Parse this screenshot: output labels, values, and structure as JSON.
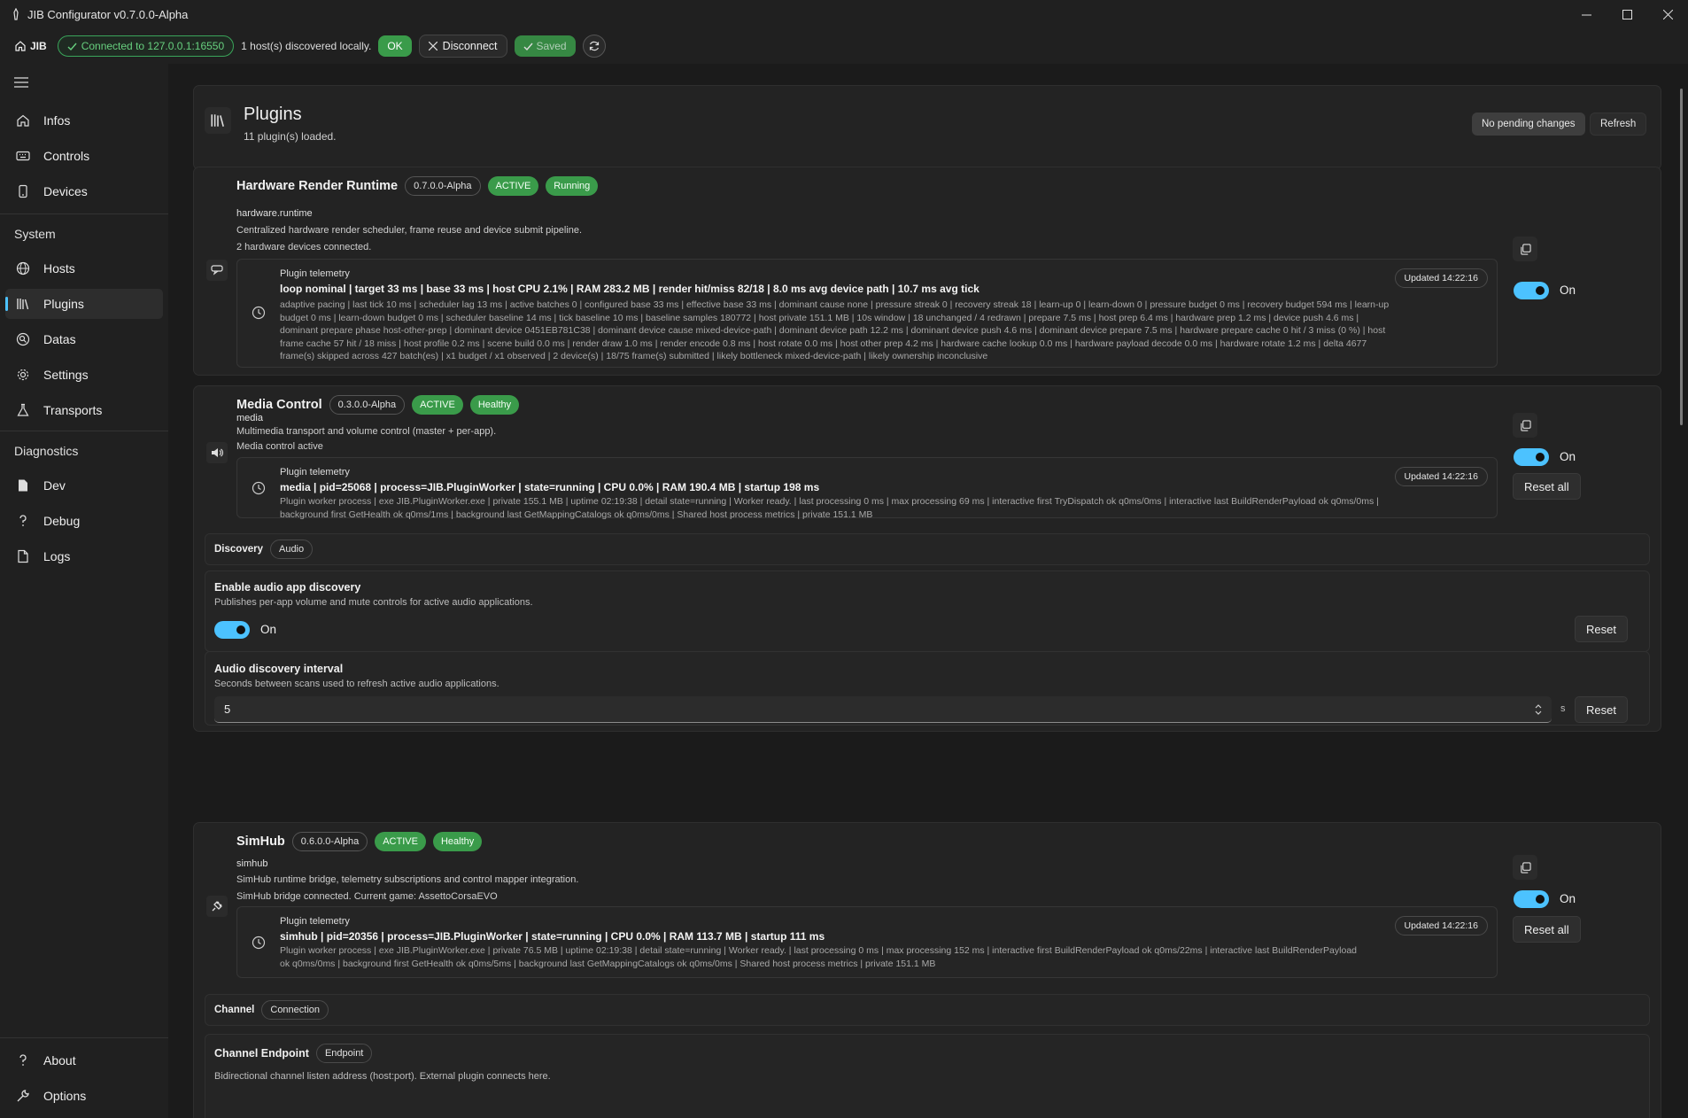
{
  "window": {
    "title": "JIB Configurator v0.7.0.0-Alpha"
  },
  "toolbar": {
    "home_label": "JIB",
    "connection_status": "Connected to 127.0.0.1:16550",
    "hosts_text": "1 host(s) discovered locally.",
    "ok_label": "OK",
    "disconnect_label": "Disconnect",
    "saved_label": "Saved"
  },
  "sidebar": {
    "top_items": [
      {
        "label": "Infos",
        "icon": "home-icon"
      },
      {
        "label": "Controls",
        "icon": "keyboard-icon"
      },
      {
        "label": "Devices",
        "icon": "phone-icon"
      }
    ],
    "system_header": "System",
    "system_items": [
      {
        "label": "Hosts",
        "icon": "globe-icon"
      },
      {
        "label": "Plugins",
        "icon": "library-icon",
        "active": true
      },
      {
        "label": "Datas",
        "icon": "data-icon"
      },
      {
        "label": "Settings",
        "icon": "gear-icon"
      },
      {
        "label": "Transports",
        "icon": "flask-icon"
      }
    ],
    "diagnostics_header": "Diagnostics",
    "diagnostics_items": [
      {
        "label": "Dev",
        "icon": "document-icon"
      },
      {
        "label": "Debug",
        "icon": "question-icon"
      },
      {
        "label": "Logs",
        "icon": "page-icon"
      }
    ],
    "bottom_items": [
      {
        "label": "About",
        "icon": "question-icon"
      },
      {
        "label": "Options",
        "icon": "wrench-icon"
      }
    ]
  },
  "page": {
    "title": "Plugins",
    "subtitle": "11 plugin(s) loaded.",
    "pending_label": "No pending changes",
    "refresh_label": "Refresh"
  },
  "plugins": [
    {
      "name": "Hardware Render Runtime",
      "version": "0.7.0.0-Alpha",
      "state": "ACTIVE",
      "health": "Running",
      "id": "hardware.runtime",
      "description": "Centralized hardware render scheduler, frame reuse and device submit pipeline.",
      "status": "2 hardware devices connected.",
      "telemetry_title": "Plugin telemetry",
      "telemetry_summary": "loop nominal | target 33 ms | base 33 ms | host CPU 2.1% | RAM 283.2 MB | render hit/miss 82/18 | 8.0 ms avg device path | 10.7 ms avg tick",
      "telemetry_detail": "adaptive pacing | last tick 10 ms | scheduler lag 13 ms | active batches 0 | configured base 33 ms | effective base 33 ms | dominant cause none | pressure streak 0 | recovery streak 18 | learn-up 0 | learn-down 0 | pressure budget 0 ms | recovery budget 594 ms | learn-up budget 0 ms | learn-down budget 0 ms | scheduler baseline 14 ms | tick baseline 10 ms | baseline samples 180772 | host private 151.1 MB | 10s window | 18 unchanged / 4 redrawn | prepare 7.5 ms | host prep 6.4 ms | hardware prep 1.2 ms | device push 4.6 ms | dominant prepare phase host-other-prep | dominant device 0451EB781C38 | dominant device cause mixed-device-path | dominant device path 12.2 ms | dominant device push 4.6 ms | dominant device prepare 7.5 ms | hardware prepare cache 0 hit / 3 miss (0 %) | host frame cache 57 hit / 18 miss | host profile 0.2 ms | scene build 0.0 ms | render draw 1.0 ms | render encode 0.8 ms | host rotate 0.0 ms | host other prep 4.2 ms | hardware cache lookup 0.0 ms | hardware payload decode 0.0 ms | hardware rotate 1.2 ms | delta 4677 frame(s) skipped across 427 batch(es) | x1 budget / x1 observed | 2 device(s) | 18/75 frame(s) submitted | likely bottleneck mixed-device-path | likely ownership inconclusive",
      "updated": "Updated 14:22:16",
      "toggle_label": "On",
      "icon": "chat-icon"
    },
    {
      "name": "Media Control",
      "version": "0.3.0.0-Alpha",
      "state": "ACTIVE",
      "health": "Healthy",
      "id": "media",
      "description": "Multimedia transport and volume control (master + per-app).",
      "status": "Media control active",
      "telemetry_title": "Plugin telemetry",
      "telemetry_summary": "media | pid=25068 | process=JIB.PluginWorker | state=running | CPU 0.0% | RAM 190.4 MB | startup 198 ms",
      "telemetry_detail": "Plugin worker process | exe JIB.PluginWorker.exe | private 155.1 MB | uptime 02:19:38 | detail state=running | Worker ready. | last processing 0 ms | max processing 69 ms | interactive first TryDispatch ok q0ms/0ms | interactive last BuildRenderPayload ok q0ms/0ms | background first GetHealth ok q0ms/1ms | background last GetMappingCatalogs ok q0ms/0ms | Shared host process metrics | private 151.1 MB",
      "updated": "Updated 14:22:16",
      "toggle_label": "On",
      "reset_all_label": "Reset all",
      "icon": "speaker-icon",
      "settings": {
        "section_title": "Discovery",
        "section_chip": "Audio",
        "discovery_title": "Enable audio app discovery",
        "discovery_desc": "Publishes per-app volume and mute controls for active audio applications.",
        "discovery_toggle": "On",
        "reset_label": "Reset",
        "interval_title": "Audio discovery interval",
        "interval_desc": "Seconds between scans used to refresh active audio applications.",
        "interval_value": "5",
        "interval_unit": "s"
      }
    },
    {
      "name": "SimHub",
      "version": "0.6.0.0-Alpha",
      "state": "ACTIVE",
      "health": "Healthy",
      "id": "simhub",
      "description": "SimHub runtime bridge, telemetry subscriptions and control mapper integration.",
      "status": "SimHub bridge connected. Current game: AssettoCorsaEVO",
      "telemetry_title": "Plugin telemetry",
      "telemetry_summary": "simhub | pid=20356 | process=JIB.PluginWorker | state=running | CPU 0.0% | RAM 113.7 MB | startup 111 ms",
      "telemetry_detail": "Plugin worker process | exe JIB.PluginWorker.exe | private 76.5 MB | uptime 02:19:38 | detail state=running | Worker ready. | last processing 0 ms | max processing 152 ms | interactive first BuildRenderPayload ok q0ms/22ms | interactive last BuildRenderPayload ok q0ms/0ms | background first GetHealth ok q0ms/5ms | background last GetMappingCatalogs ok q0ms/0ms | Shared host process metrics | private 151.1 MB",
      "updated": "Updated 14:22:16",
      "toggle_label": "On",
      "reset_all_label": "Reset all",
      "icon": "plug-icon",
      "settings": {
        "section_title": "Channel",
        "section_chip": "Connection",
        "endpoint_title": "Channel Endpoint",
        "endpoint_chip": "Endpoint",
        "endpoint_desc": "Bidirectional channel listen address (host:port). External plugin connects here."
      }
    }
  ],
  "colors": {
    "accent": "#4cc2ff",
    "success": "#3a9b4a",
    "background": "#1b1b1b",
    "card": "#232323"
  }
}
